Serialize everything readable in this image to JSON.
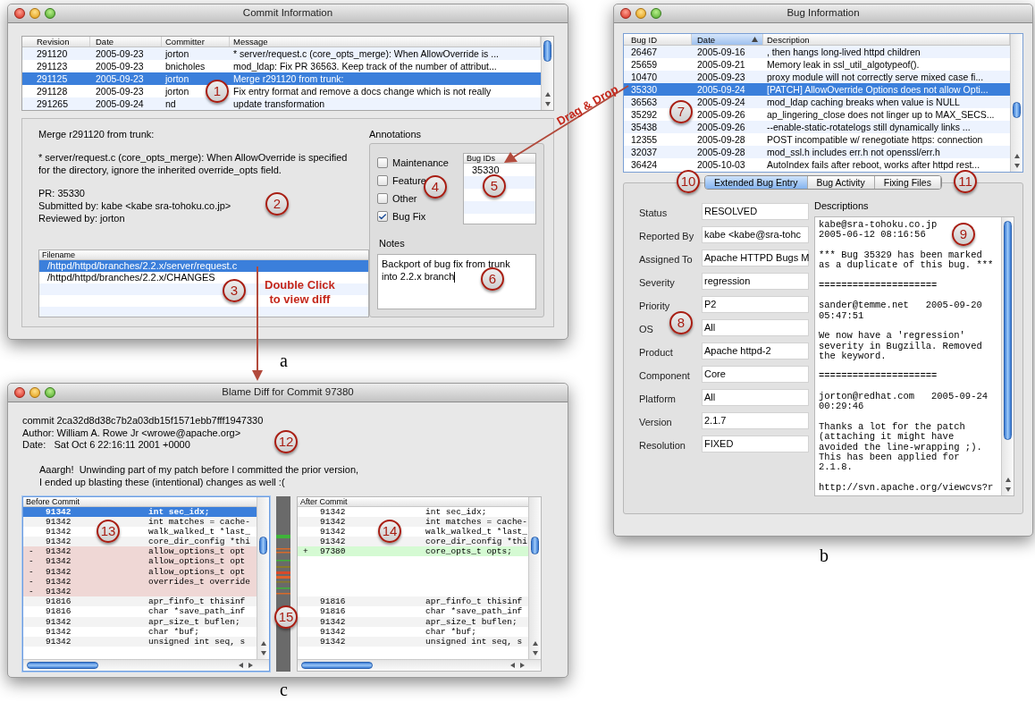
{
  "commit_window": {
    "title": "Commit Information",
    "caption": "a",
    "revisions": {
      "columns": [
        "Revision",
        "Date",
        "Committer",
        "Message"
      ],
      "rows": [
        {
          "revision": "291120",
          "date": "2005-09-23",
          "committer": "jorton",
          "message": "* server/request.c (core_opts_merge): When AllowOverride is ...",
          "selected": false
        },
        {
          "revision": "291123",
          "date": "2005-09-23",
          "committer": "bnicholes",
          "message": "mod_ldap: Fix PR 36563. Keep track of the number of attribut...",
          "selected": false
        },
        {
          "revision": "291125",
          "date": "2005-09-23",
          "committer": "jorton",
          "message": "Merge r291120 from trunk:",
          "selected": true
        },
        {
          "revision": "291128",
          "date": "2005-09-23",
          "committer": "jorton",
          "message": "Fix entry format and remove a docs change which is not really",
          "selected": false
        },
        {
          "revision": "291265",
          "date": "2005-09-24",
          "committer": "nd",
          "message": "update transformation",
          "selected": false
        }
      ]
    },
    "message": [
      [
        "Merge r291120 from trunk:"
      ],
      [
        "* server/request.c (core_opts_merge): When AllowOverride is specified",
        "for the directory, ignore the inherited override_opts field."
      ],
      [
        "PR: 35330",
        "Submitted by: kabe <kabe sra-tohoku.co.jp>",
        "Reviewed by: jorton"
      ]
    ],
    "files": {
      "column": "Filename",
      "rows": [
        {
          "path": "/httpd/httpd/branches/2.2.x/server/request.c",
          "selected": true
        },
        {
          "path": "/httpd/httpd/branches/2.2.x/CHANGES",
          "selected": false
        }
      ]
    },
    "annotations": {
      "title": "Annotations",
      "categories": [
        {
          "label": "Maintenance",
          "checked": false
        },
        {
          "label": "Feature",
          "checked": false
        },
        {
          "label": "Other",
          "checked": false
        },
        {
          "label": "Bug Fix",
          "checked": true
        }
      ],
      "bug_ids": {
        "column": "Bug IDs",
        "rows": [
          "35330"
        ]
      },
      "notes_label": "Notes",
      "notes": [
        "Backport of bug fix from trunk",
        "into 2.2.x branch"
      ]
    }
  },
  "bug_window": {
    "title": "Bug Information",
    "caption": "b",
    "bugs": {
      "columns": [
        {
          "label": "Bug ID",
          "sorted": false
        },
        {
          "label": "Date",
          "sorted": true
        },
        {
          "label": "Description",
          "sorted": false
        }
      ],
      "rows": [
        {
          "id": "26467",
          "date": "2005-09-16",
          "description": ", then hangs long-lived httpd children",
          "selected": false
        },
        {
          "id": "25659",
          "date": "2005-09-21",
          "description": "Memory leak in ssl_util_algotypeof().",
          "selected": false
        },
        {
          "id": "10470",
          "date": "2005-09-23",
          "description": "proxy module will not correctly serve mixed case fi...",
          "selected": false
        },
        {
          "id": "35330",
          "date": "2005-09-24",
          "description": "[PATCH] AllowOverride Options does not allow Opti...",
          "selected": true
        },
        {
          "id": "36563",
          "date": "2005-09-24",
          "description": "mod_ldap caching breaks when value is NULL",
          "selected": false
        },
        {
          "id": "35292",
          "date": "2005-09-26",
          "description": "ap_lingering_close does not linger up to MAX_SECS...",
          "selected": false
        },
        {
          "id": "35438",
          "date": "2005-09-26",
          "description": "--enable-static-rotatelogs still dynamically links ...",
          "selected": false
        },
        {
          "id": "12355",
          "date": "2005-09-28",
          "description": "POST incompatible w/ renegotiate https: connection",
          "selected": false
        },
        {
          "id": "32037",
          "date": "2005-09-28",
          "description": "mod_ssl.h includes err.h not openssl/err.h",
          "selected": false
        },
        {
          "id": "36424",
          "date": "2005-10-03",
          "description": "AutoIndex fails after reboot, works after httpd rest...",
          "selected": false
        }
      ]
    },
    "tabs": [
      {
        "label": "Extended Bug Entry",
        "selected": true
      },
      {
        "label": "Bug Activity",
        "selected": false
      },
      {
        "label": "Fixing Files",
        "selected": false
      }
    ],
    "fields": [
      {
        "label": "Status",
        "value": "RESOLVED"
      },
      {
        "label": "Reported By",
        "value": "kabe <kabe@sra-tohc"
      },
      {
        "label": "Assigned To",
        "value": "Apache HTTPD Bugs M"
      },
      {
        "label": "Severity",
        "value": "regression"
      },
      {
        "label": "Priority",
        "value": "P2"
      },
      {
        "label": "OS",
        "value": "All"
      },
      {
        "label": "Product",
        "value": "Apache httpd-2"
      },
      {
        "label": "Component",
        "value": "Core"
      },
      {
        "label": "Platform",
        "value": "All"
      },
      {
        "label": "Version",
        "value": "2.1.7"
      },
      {
        "label": "Resolution",
        "value": "FIXED"
      }
    ],
    "descriptions_label": "Descriptions",
    "descriptions": [
      [
        "kabe@sra-tohoku.co.jp",
        "2005-06-12 08:16:56"
      ],
      [
        "*** Bug 35329 has been marked",
        "as a duplicate of this bug. ***"
      ],
      [
        "====================="
      ],
      [
        "sander@temme.net   2005-09-20",
        "05:47:51"
      ],
      [
        "We now have a 'regression'",
        "severity in Bugzilla. Removed",
        "the keyword."
      ],
      [
        "====================="
      ],
      [
        "jorton@redhat.com   2005-09-24",
        "00:29:46"
      ],
      [
        "Thanks a lot for the patch",
        "(attaching it might have",
        "avoided the line-wrapping ;).",
        "This has been applied for",
        "2.1.8."
      ],
      [
        "http://svn.apache.org/viewcvs?r"
      ]
    ]
  },
  "diff_window": {
    "title": "Blame Diff for Commit 97380",
    "caption": "c",
    "header": [
      "commit 2ca32d8d38c7b2a03db15f1571ebb7fff1947330",
      "Author: William A. Rowe Jr <wrowe@apache.org>",
      "Date:   Sat Oct 6 22:16:11 2001 +0000"
    ],
    "message": [
      "Aaargh!  Unwinding part of my patch before I committed the prior version,",
      "I ended up blasting these (intentional) changes as well :("
    ],
    "before": {
      "title": "Before Commit",
      "rows": [
        {
          "kind": "selected",
          "rev": "91342",
          "code": "int sec_idx;"
        },
        {
          "kind": "normal",
          "rev": "91342",
          "code": "int matches = cache-"
        },
        {
          "kind": "normal",
          "rev": "91342",
          "code": "walk_walked_t *last_"
        },
        {
          "kind": "normal",
          "rev": "91342",
          "code": "core_dir_config *thi"
        },
        {
          "kind": "removed",
          "marker": "-",
          "rev": "91342",
          "code": "allow_options_t opt"
        },
        {
          "kind": "removed",
          "marker": "-",
          "rev": "91342",
          "code": "allow_options_t opt"
        },
        {
          "kind": "removed",
          "marker": "-",
          "rev": "91342",
          "code": "allow_options_t opt"
        },
        {
          "kind": "removed",
          "marker": "-",
          "rev": "91342",
          "code": "overrides_t override"
        },
        {
          "kind": "removed",
          "marker": "-",
          "rev": "91342"
        },
        {
          "kind": "normal",
          "rev": "91816",
          "code": "apr_finfo_t thisinf"
        },
        {
          "kind": "normal",
          "rev": "91816",
          "code": "char *save_path_inf"
        },
        {
          "kind": "normal",
          "rev": "91342",
          "code": "apr_size_t buflen;"
        },
        {
          "kind": "normal",
          "rev": "91342",
          "code": "char *buf;"
        },
        {
          "kind": "normal",
          "rev": "91342",
          "code": "unsigned int seq, s"
        }
      ]
    },
    "after": {
      "title": "After Commit",
      "rows": [
        {
          "kind": "normal",
          "rev": "91342",
          "code": "int sec_idx;"
        },
        {
          "kind": "normal",
          "rev": "91342",
          "code": "int matches = cache-"
        },
        {
          "kind": "normal",
          "rev": "91342",
          "code": "walk_walked_t *last_"
        },
        {
          "kind": "normal",
          "rev": "91342",
          "code": "core_dir_config *thi"
        },
        {
          "kind": "added",
          "marker": "+",
          "rev": "97380",
          "code": "core_opts_t opts;"
        },
        {
          "kind": "blank"
        },
        {
          "kind": "blank"
        },
        {
          "kind": "blank"
        },
        {
          "kind": "blank"
        },
        {
          "kind": "normal",
          "rev": "91816",
          "code": "apr_finfo_t thisinf"
        },
        {
          "kind": "normal",
          "rev": "91816",
          "code": "char *save_path_inf"
        },
        {
          "kind": "normal",
          "rev": "91342",
          "code": "apr_size_t buflen;"
        },
        {
          "kind": "normal",
          "rev": "91342",
          "code": "char *buf;"
        },
        {
          "kind": "normal",
          "rev": "91342",
          "code": "unsigned int seq, s"
        }
      ]
    }
  },
  "drag_label": "Drag & Drop",
  "double_click_label": [
    "Double Click",
    "to view diff"
  ],
  "callouts": [
    "1",
    "2",
    "3",
    "4",
    "5",
    "6",
    "7",
    "8",
    "9",
    "10",
    "11",
    "12",
    "13",
    "14",
    "15"
  ]
}
